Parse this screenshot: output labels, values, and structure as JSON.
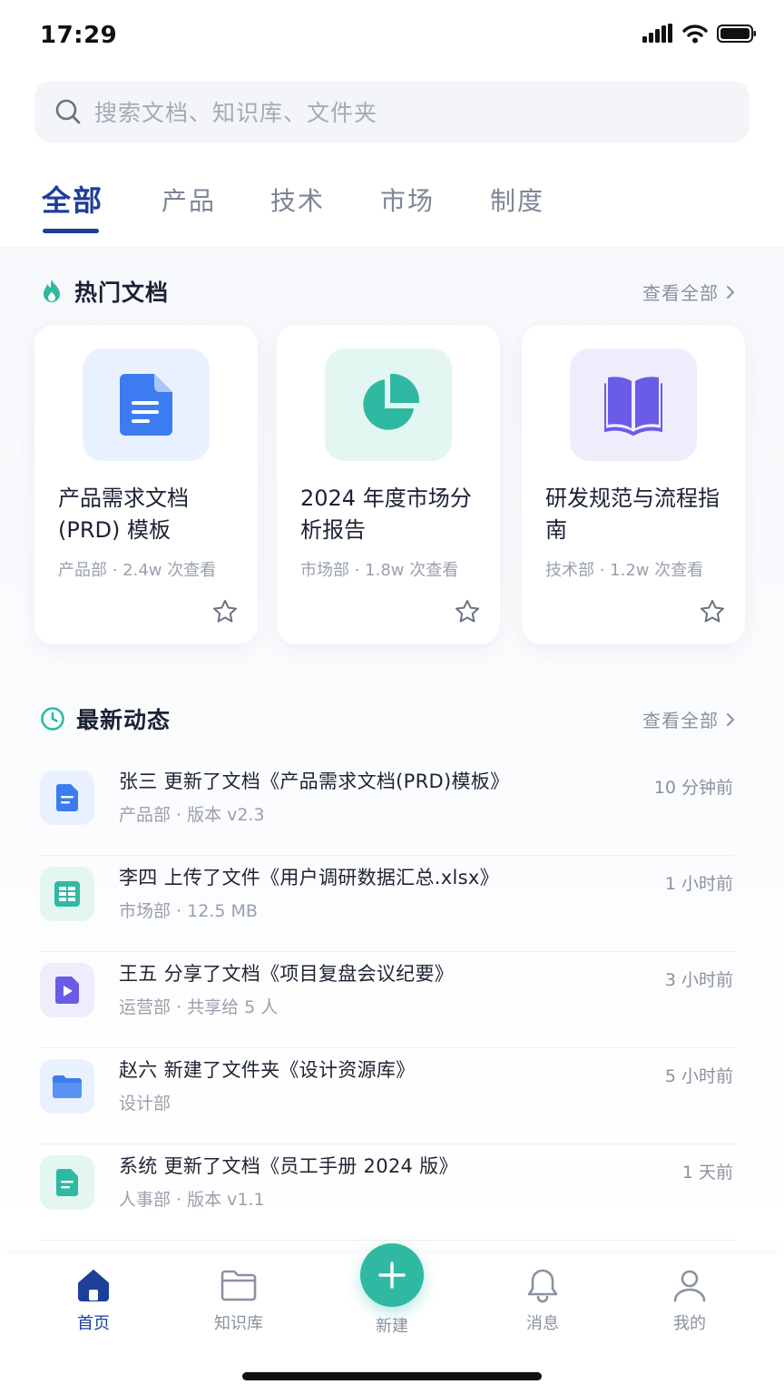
{
  "status_bar": {
    "time": "17:29"
  },
  "search": {
    "placeholder": "搜索文档、知识库、文件夹"
  },
  "tabs": [
    {
      "label": "全部",
      "active": true
    },
    {
      "label": "产品"
    },
    {
      "label": "技术"
    },
    {
      "label": "市场"
    },
    {
      "label": "制度"
    }
  ],
  "hot": {
    "title": "热门文档",
    "more": "查看全部",
    "cards": [
      {
        "title": "产品需求文档 (PRD) 模板",
        "meta": "产品部 · 2.4w 次查看",
        "icon": "document-icon",
        "color": "#3d7cf0"
      },
      {
        "title": "2024 年度市场分析报告",
        "meta": "市场部 · 1.8w 次查看",
        "icon": "pie-chart-icon",
        "color": "#2fb9a3"
      },
      {
        "title": "研发规范与流程指南",
        "meta": "技术部 · 1.2w 次查看",
        "icon": "book-icon",
        "color": "#6a5ce6"
      }
    ]
  },
  "recent": {
    "title": "最新动态",
    "more": "查看全部",
    "items": [
      {
        "title": "张三 更新了文档《产品需求文档(PRD)模板》",
        "sub": "产品部 · 版本 v2.3",
        "time": "10 分钟前",
        "icon": "document-icon"
      },
      {
        "title": "李四 上传了文件《用户调研数据汇总.xlsx》",
        "sub": "市场部 · 12.5 MB",
        "time": "1 小时前",
        "icon": "spreadsheet-icon"
      },
      {
        "title": "王五 分享了文档《项目复盘会议纪要》",
        "sub": "运营部 · 共享给 5 人",
        "time": "3 小时前",
        "icon": "video-file-icon"
      },
      {
        "title": "赵六 新建了文件夹《设计资源库》",
        "sub": "设计部",
        "time": "5 小时前",
        "icon": "folder-icon"
      },
      {
        "title": "系统 更新了文档《员工手册 2024 版》",
        "sub": "人事部 · 版本 v1.1",
        "time": "1 天前",
        "icon": "document-icon"
      }
    ]
  },
  "nav": {
    "home": "首页",
    "library": "知识库",
    "create": "新建",
    "messages": "消息",
    "me": "我的"
  },
  "colors": {
    "primary": "#1d3f9a",
    "accent": "#2fb9a3",
    "blue": "#3d7cf0",
    "purple": "#6a5ce6"
  }
}
